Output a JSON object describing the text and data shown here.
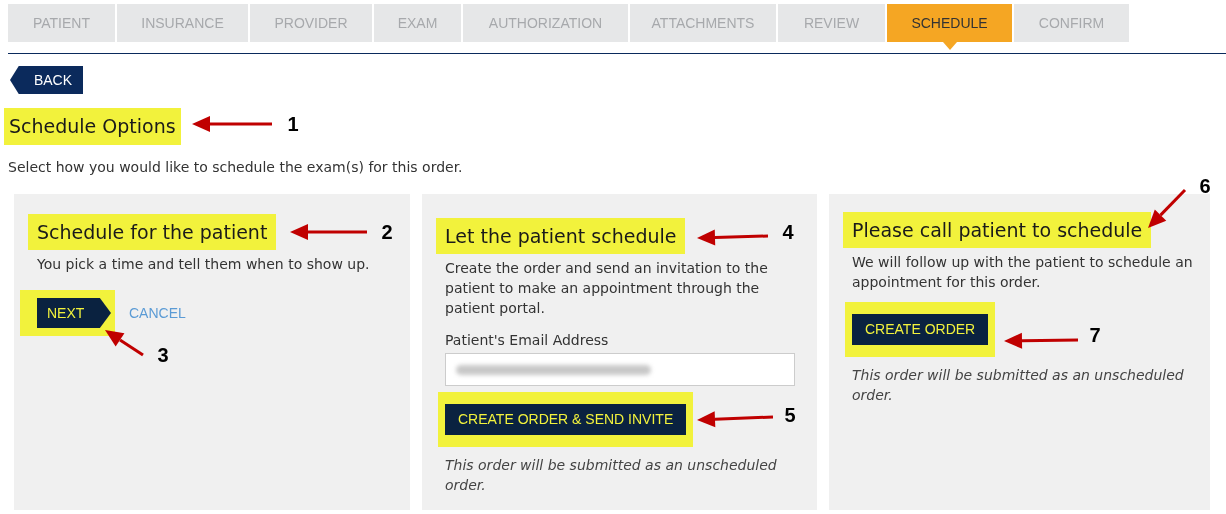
{
  "tabs": [
    {
      "label": "PATIENT",
      "selected": false
    },
    {
      "label": "INSURANCE",
      "selected": false
    },
    {
      "label": "PROVIDER",
      "selected": false
    },
    {
      "label": "EXAM",
      "selected": false
    },
    {
      "label": "AUTHORIZATION",
      "selected": false
    },
    {
      "label": "ATTACHMENTS",
      "selected": false
    },
    {
      "label": "REVIEW",
      "selected": false
    },
    {
      "label": "SCHEDULE",
      "selected": true
    },
    {
      "label": "CONFIRM",
      "selected": false
    }
  ],
  "back_button": "BACK",
  "title": "Schedule Options",
  "description": "Select how you would like to schedule the exam(s) for this order.",
  "options": [
    {
      "kind": "pick",
      "heading": "Schedule for the patient",
      "text": "You pick a time and tell them when to show up.",
      "primary_button": "NEXT",
      "secondary_link": "CANCEL"
    },
    {
      "kind": "invite",
      "heading": "Let the patient schedule",
      "text": "Create the order and send an invitation to the patient to make an appointment through the patient portal.",
      "field_label": "Patient's Email Address",
      "primary_button": "CREATE ORDER & SEND INVITE",
      "note": "This order will be submitted as an unscheduled order."
    },
    {
      "kind": "call",
      "heading": "Please call patient to schedule",
      "text": "We will follow up with the patient to schedule an appointment for this order.",
      "primary_button": "CREATE ORDER",
      "note": "This order will be submitted as an unscheduled order."
    }
  ],
  "annotations": [
    {
      "label": "1"
    },
    {
      "label": "2"
    },
    {
      "label": "3"
    },
    {
      "label": "4"
    },
    {
      "label": "5"
    },
    {
      "label": "6"
    },
    {
      "label": "7"
    }
  ]
}
